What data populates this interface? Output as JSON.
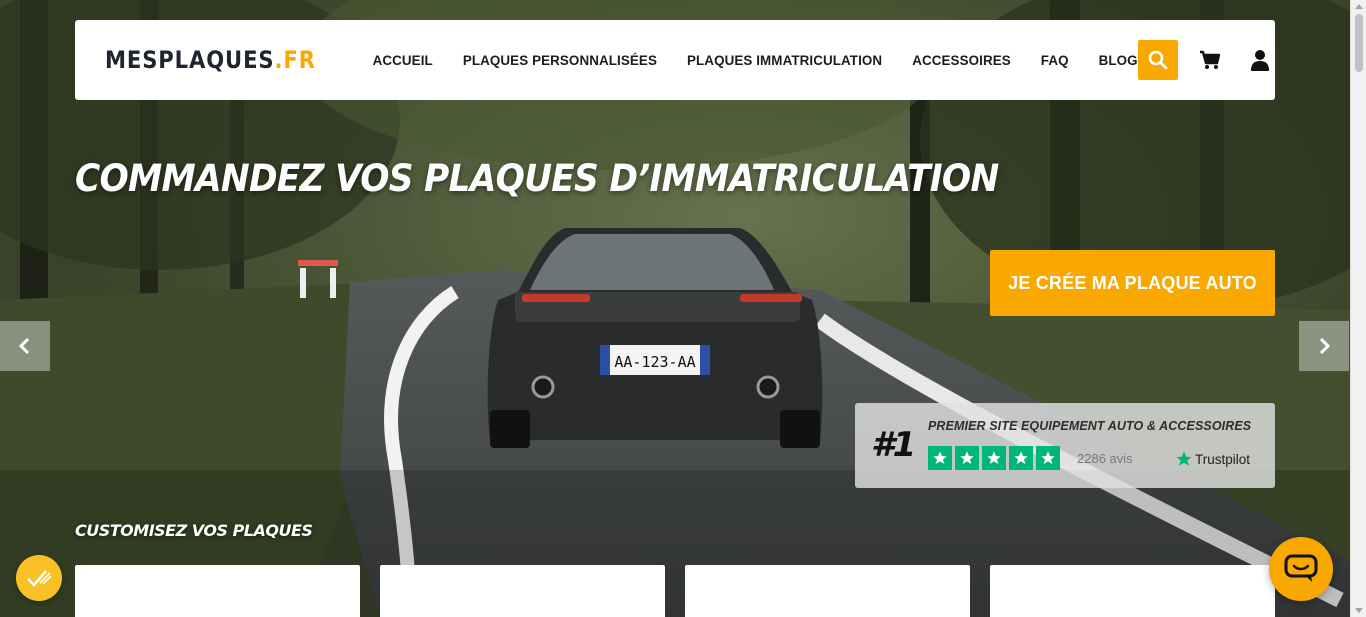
{
  "brand": {
    "name": "MESPLAQUES",
    "suffix": ".FR",
    "accent_color": "#f9a800"
  },
  "nav": {
    "links": [
      {
        "label": "ACCUEIL"
      },
      {
        "label": "PLAQUES PERSONNALISÉES"
      },
      {
        "label": "PLAQUES IMMATRICULATION"
      },
      {
        "label": "ACCESSOIRES"
      },
      {
        "label": "FAQ"
      },
      {
        "label": "BLOG"
      }
    ],
    "icons": [
      "search-icon",
      "cart-icon",
      "user-icon"
    ]
  },
  "hero": {
    "title": "COMMANDEZ VOS PLAQUES D’IMMATRICULATION",
    "cta_label": "JE CRÉE MA PLAQUE AUTO",
    "plate_text": "AA-123-AA"
  },
  "slider": {
    "prev_icon": "chevron-left-icon",
    "next_icon": "chevron-right-icon"
  },
  "trust": {
    "rank": "#1",
    "heading": "PREMIER SITE EQUIPEMENT AUTO & ACCESSOIRES",
    "rating_stars": 5,
    "review_count": "2286 avis",
    "provider": "Trustpilot",
    "star_color": "#00b67a"
  },
  "customise": {
    "title": "CUSTOMISEZ VOS PLAQUES",
    "card_count": 4
  },
  "widgets": {
    "cookie_icon": "cookie-consent-icon",
    "chat_icon": "chat-icon"
  }
}
